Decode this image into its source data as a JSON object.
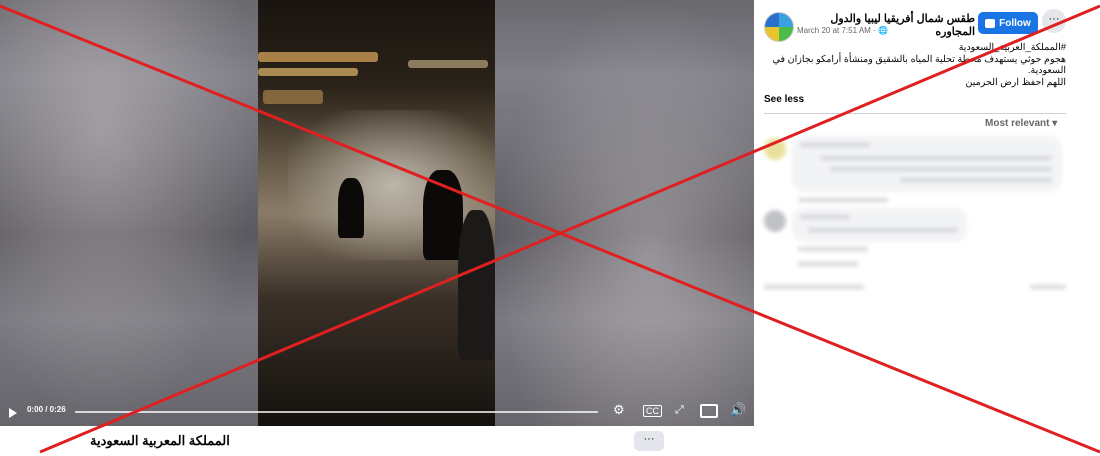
{
  "video": {
    "time_display": "0:00 / 0:26",
    "progress_fraction": 0.0
  },
  "below_video": {
    "title": "المملكة المعربية السعودية",
    "more_label": "···"
  },
  "post": {
    "page_name": "طقس شمال أفريقيا ليبيا والدول المجاوره",
    "meta": "March 20 at 7:51 AM · ",
    "follow_label": "Follow",
    "more_label": "···",
    "text_lines": [
      "#المملكة_العربية_السعودية",
      "هجوم حوثي يستهدف محطة تحلية المياه بالشقيق ومنشأة أرامكو بجازان في",
      "السعودية.",
      "اللهم احفظ ارض الحرمين"
    ],
    "see_less": "See less"
  },
  "comments": {
    "sort_label": "Most relevant ▾"
  },
  "colors": {
    "follow_blue": "#1b74e4",
    "cross_red": "#e02020"
  },
  "icons": [
    "play-icon",
    "settings-icon",
    "captions-icon",
    "fullscreen-icon",
    "pip-icon",
    "volume-icon",
    "globe-icon",
    "follow-icon"
  ]
}
